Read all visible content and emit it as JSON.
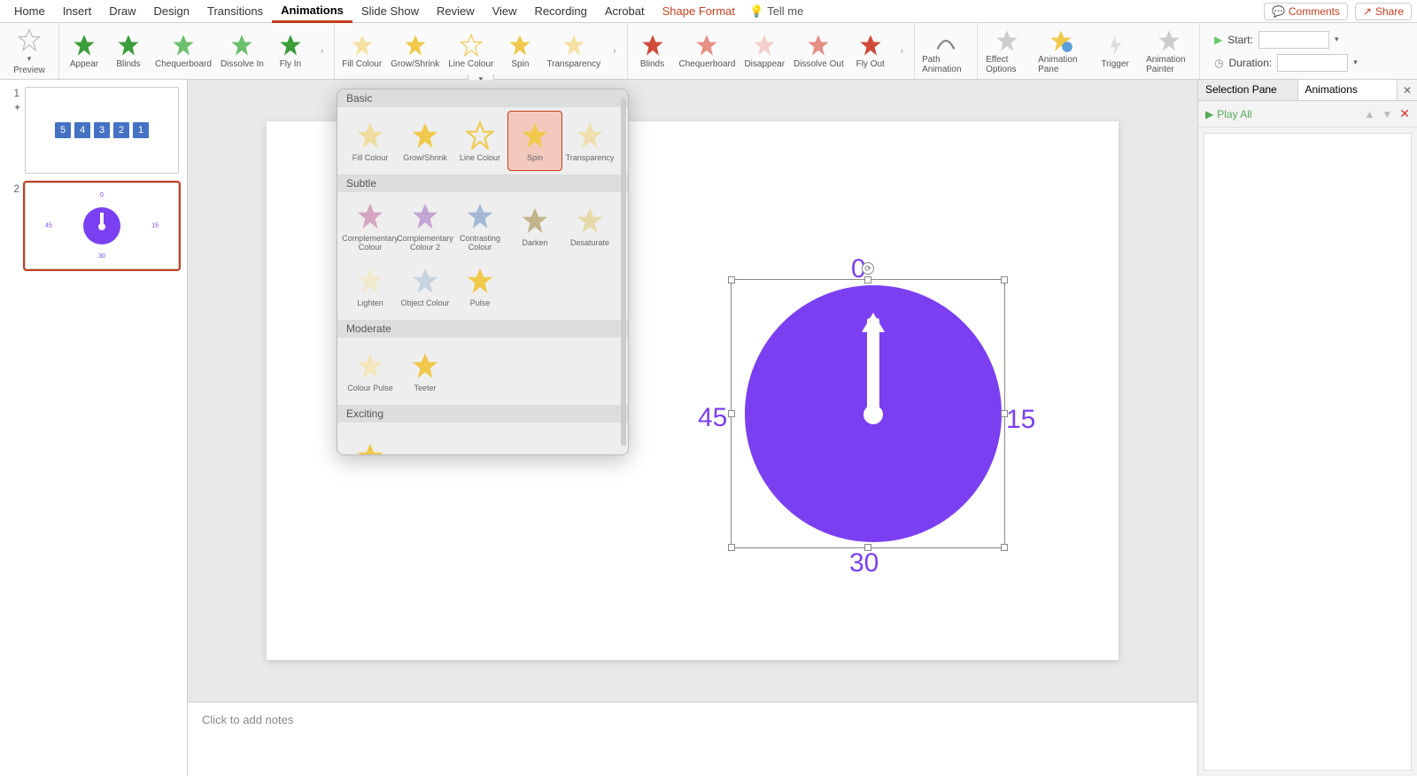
{
  "tabs": {
    "items": [
      "Home",
      "Insert",
      "Draw",
      "Design",
      "Transitions",
      "Animations",
      "Slide Show",
      "Review",
      "View",
      "Recording",
      "Acrobat",
      "Shape Format"
    ],
    "active": "Animations",
    "tellme": "Tell me"
  },
  "topright": {
    "comments": "Comments",
    "share": "Share"
  },
  "ribbon": {
    "preview": "Preview",
    "entrance": [
      "Appear",
      "Blinds",
      "Chequerboard",
      "Dissolve In",
      "Fly In"
    ],
    "emphasis_row": [
      "Fill Colour",
      "Grow/Shrink",
      "Line Colour",
      "Spin",
      "Transparency"
    ],
    "exit": [
      "Blinds",
      "Chequerboard",
      "Disappear",
      "Dissolve Out",
      "Fly Out"
    ],
    "path": "Path Animation",
    "effect": "Effect Options",
    "pane": "Animation Pane",
    "trigger": "Trigger",
    "painter": "Animation Painter",
    "timing": {
      "start_label": "Start:",
      "start_value": "",
      "dur_label": "Duration:",
      "dur_value": ""
    }
  },
  "popover": {
    "sections": {
      "basic": {
        "title": "Basic",
        "items": [
          "Fill Colour",
          "Grow/Shrink",
          "Line Colour",
          "Spin",
          "Transparency"
        ]
      },
      "subtle": {
        "title": "Subtle",
        "items": [
          "Complementary Colour",
          "Complementary Colour 2",
          "Contrasting Colour",
          "Darken",
          "Desaturate",
          "Lighten",
          "Object Colour",
          "Pulse"
        ]
      },
      "moderate": {
        "title": "Moderate",
        "items": [
          "Colour Pulse",
          "Teeter"
        ]
      },
      "exciting": {
        "title": "Exciting"
      }
    },
    "selected": "Spin"
  },
  "thumbs": {
    "s1": {
      "num": "1",
      "boxes": [
        "5",
        "4",
        "3",
        "2",
        "1"
      ]
    },
    "s2": {
      "num": "2"
    }
  },
  "slide": {
    "labels": {
      "top": "0",
      "right": "15",
      "bottom": "30",
      "left": "45"
    }
  },
  "notes": {
    "placeholder": "Click to add notes"
  },
  "right": {
    "tab1": "Selection Pane",
    "tab2": "Animations",
    "play": "Play All"
  }
}
